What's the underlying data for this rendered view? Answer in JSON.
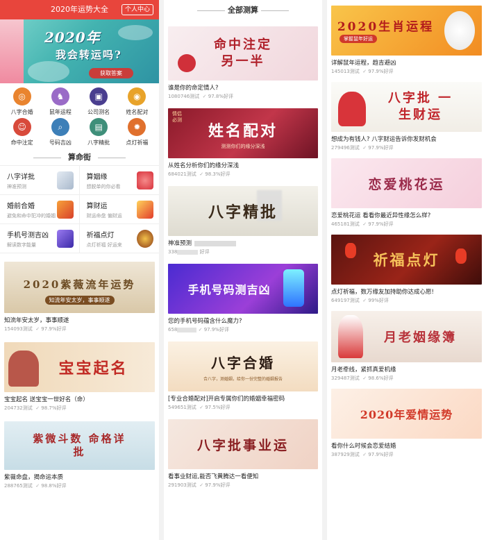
{
  "header": {
    "title": "2020年运势大全",
    "profile_btn": "个人中心"
  },
  "hero": {
    "line1": "2020年",
    "line2": "我会转运吗?",
    "button": "获取答案"
  },
  "icons": [
    {
      "label": "八字合婚",
      "icon": "rings-icon",
      "color": "#e9842f"
    },
    {
      "label": "鼠年运程",
      "icon": "rat-icon",
      "color": "#9a6bc7"
    },
    {
      "label": "公司测名",
      "icon": "briefcase-icon",
      "color": "#4a3e8f"
    },
    {
      "label": "姓名配对",
      "icon": "coin-icon",
      "color": "#e8a32a"
    },
    {
      "label": "命中注定",
      "icon": "person-icon",
      "color": "#d84a3b"
    },
    {
      "label": "号码吉凶",
      "icon": "magnifier-icon",
      "color": "#3d7fb8"
    },
    {
      "label": "八字精批",
      "icon": "book-icon",
      "color": "#3f8f7a"
    },
    {
      "label": "点灯祈福",
      "icon": "lantern-icon",
      "color": "#e0702d"
    }
  ],
  "section_suanming": "算命街",
  "jie": [
    {
      "title": "八字详批",
      "sub": "神准预测",
      "color": "#c8d4e3"
    },
    {
      "title": "算姻缘",
      "sub": "想脱单的你必看",
      "color": "#e3525b"
    },
    {
      "title": "婚前合婚",
      "sub": "避免和命中犯冲的婚姻",
      "color": "#e5502c"
    },
    {
      "title": "算财运",
      "sub": "财运命盘 偏财运",
      "color": "#f0b02b"
    },
    {
      "title": "手机号测吉凶",
      "sub": "解读数字能量",
      "color": "#6a4ed1"
    },
    {
      "title": "祈福点灯",
      "sub": "点灯祈福 好运来",
      "color": "#b0501f"
    }
  ],
  "col1_cards": [
    {
      "banner": "2020紫薇流年运势",
      "sub": "知流年安太岁，事事顺遂",
      "title": "知流年安太岁，事事顺遂",
      "tests": "154093测试",
      "good": "97.9%好评"
    },
    {
      "banner": "宝宝起名",
      "title": "宝宝起名 送宝宝一世好名（命）",
      "tests": "204732测试",
      "good": "98.7%好评"
    },
    {
      "banner": "紫微斗数 命格详批",
      "title": "紫薇命盘，揭命运本质",
      "tests": "288765测试",
      "good": "98.8%好评"
    }
  ],
  "section_all": "全部测算",
  "col2_cards": [
    {
      "banner": "命中注定 另一半",
      "title": "谁是你的命定情人?",
      "tests": "1080746测试",
      "good": "97.8%好评"
    },
    {
      "banner": "姓名配对",
      "sub": "测测你们的缘分深浅",
      "badge": "情侣必测",
      "title": "从姓名分析你们的缘分深浅",
      "tests": "684021测试",
      "good": "98.3%好评"
    },
    {
      "banner": "八字精批",
      "title": "神准预测",
      "tests": "338",
      "good": "好评"
    },
    {
      "banner": "手机号码测吉凶",
      "title": "您的手机号码蕴含什么魔力?",
      "tests": "658",
      "good": "97.9%好评"
    },
    {
      "banner": "八字合婚",
      "sub": "合八字，测婚姻，给你一份完整的婚姻报告",
      "title": "[专业合婚配对]开启专属你们的婚姻幸福密码",
      "tests": "549651测试",
      "good": "97.5%好评"
    },
    {
      "banner": "八字批事业运",
      "title": "看事业财运,能否飞黄腾达一看便知",
      "tests": "291903测试",
      "good": "97.9%好评"
    }
  ],
  "col3_cards": [
    {
      "banner": "2020生肖运程",
      "sub": "掌握鼠年好运",
      "title": "详解鼠年运程，趋吉避凶",
      "tests": "145013测试",
      "good": "97.9%好评"
    },
    {
      "banner": "八字批 一生财运",
      "title": "想成为有钱人? 八字财运告诉你发财机会",
      "tests": "279496测试",
      "good": "97.9%好评"
    },
    {
      "banner": "恋爱桃花运",
      "title": "恋爱桃花运 看看你最近异性缘怎么样?",
      "tests": "465181测试",
      "good": "97.9%好评"
    },
    {
      "banner": "祈福点灯",
      "title": "点灯祈福，数万缘友加持助你达成心愿!",
      "tests": "649197测试",
      "good": "99%好评"
    },
    {
      "banner": "月老姻缘簿",
      "title": "月老牵线，紧抓真爱机缘",
      "tests": "329487测试",
      "good": "98.6%好评"
    },
    {
      "banner": "2020年爱情运势",
      "title": "看你什么时候会恋爱结婚",
      "tests": "387929测试",
      "good": "97.9%好评"
    }
  ]
}
